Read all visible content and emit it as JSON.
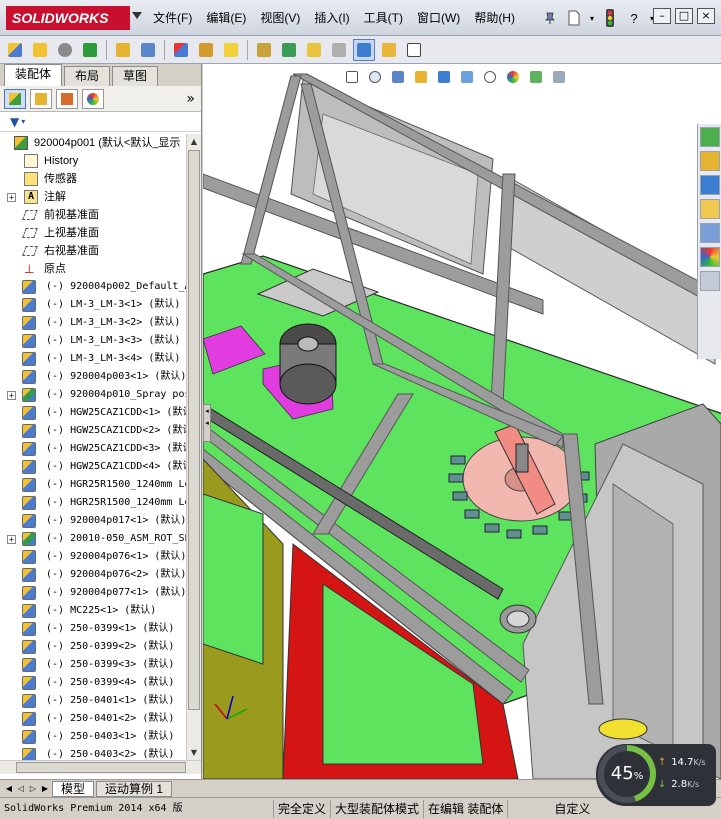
{
  "app": {
    "brand": "SOLIDWORKS",
    "menus": [
      "文件(F)",
      "编辑(E)",
      "视图(V)",
      "插入(I)",
      "工具(T)",
      "窗口(W)",
      "帮助(H)"
    ],
    "help_label": "?"
  },
  "panel": {
    "tabs": [
      "装配体",
      "布局",
      "草图"
    ],
    "active_tab": "装配体"
  },
  "tree": {
    "root": "920004p001  (默认<默认_显示",
    "items": [
      {
        "label": "History",
        "icon": "history-icon",
        "kind": "lvl1",
        "expand": false
      },
      {
        "label": "传感器",
        "icon": "sensor-icon",
        "kind": "lvl1",
        "expand": false
      },
      {
        "label": "注解",
        "icon": "annotation-icon",
        "kind": "lvl1",
        "expand": true
      },
      {
        "label": "前视基准面",
        "icon": "plane-icon",
        "kind": "lvl1",
        "expand": false
      },
      {
        "label": "上视基准面",
        "icon": "plane-icon",
        "kind": "lvl1",
        "expand": false
      },
      {
        "label": "右视基准面",
        "icon": "plane-icon",
        "kind": "lvl1",
        "expand": false
      },
      {
        "label": "原点",
        "icon": "origin-icon",
        "kind": "lvl1",
        "expand": false
      },
      {
        "label": "(-) 920004p002_Default_A",
        "icon": "part-icon",
        "kind": "comp",
        "expand": false
      },
      {
        "label": "(-) LM-3_LM-3<1> (默认)",
        "icon": "part-icon",
        "kind": "comp",
        "expand": false
      },
      {
        "label": "(-) LM-3_LM-3<2> (默认)",
        "icon": "part-icon",
        "kind": "comp",
        "expand": false
      },
      {
        "label": "(-) LM-3_LM-3<3> (默认)",
        "icon": "part-icon",
        "kind": "comp",
        "expand": false
      },
      {
        "label": "(-) LM-3_LM-3<4> (默认)",
        "icon": "part-icon",
        "kind": "comp",
        "expand": false
      },
      {
        "label": "(-) 920004p003<1> (默认)",
        "icon": "part-icon",
        "kind": "comp",
        "expand": false
      },
      {
        "label": "(-) 920004p010_Spray pos",
        "icon": "subassembly-icon",
        "kind": "comp",
        "expand": true
      },
      {
        "label": "(-) HGW25CAZ1CDD<1> (默认",
        "icon": "part-icon",
        "kind": "comp",
        "expand": false
      },
      {
        "label": "(-) HGW25CAZ1CDD<2> (默认",
        "icon": "part-icon",
        "kind": "comp",
        "expand": false
      },
      {
        "label": "(-) HGW25CAZ1CDD<3> (默认",
        "icon": "part-icon",
        "kind": "comp",
        "expand": false
      },
      {
        "label": "(-) HGW25CAZ1CDD<4> (默认",
        "icon": "part-icon",
        "kind": "comp",
        "expand": false
      },
      {
        "label": "(-) HGR25R1500_1240mm Le",
        "icon": "part-icon",
        "kind": "comp",
        "expand": false
      },
      {
        "label": "(-) HGR25R1500_1240mm Le",
        "icon": "part-icon",
        "kind": "comp",
        "expand": false
      },
      {
        "label": "(-) 920004p017<1> (默认)",
        "icon": "part-icon",
        "kind": "comp",
        "expand": false
      },
      {
        "label": "(-) 20010-050_ASM_ROT_SP",
        "icon": "subassembly-icon",
        "kind": "comp",
        "expand": true
      },
      {
        "label": "(-) 920004p076<1> (默认)",
        "icon": "part-icon",
        "kind": "comp",
        "expand": false
      },
      {
        "label": "(-) 920004p076<2> (默认)",
        "icon": "part-icon",
        "kind": "comp",
        "expand": false
      },
      {
        "label": "(-) 920004p077<1> (默认)",
        "icon": "part-icon",
        "kind": "comp",
        "expand": false
      },
      {
        "label": "(-) MC225<1> (默认)",
        "icon": "part-icon",
        "kind": "comp",
        "expand": false
      },
      {
        "label": "(-) 250-0399<1> (默认)",
        "icon": "part-icon",
        "kind": "comp",
        "expand": false
      },
      {
        "label": "(-) 250-0399<2> (默认)",
        "icon": "part-icon",
        "kind": "comp",
        "expand": false
      },
      {
        "label": "(-) 250-0399<3> (默认)",
        "icon": "part-icon",
        "kind": "comp",
        "expand": false
      },
      {
        "label": "(-) 250-0399<4> (默认)",
        "icon": "part-icon",
        "kind": "comp",
        "expand": false
      },
      {
        "label": "(-) 250-0401<1> (默认)",
        "icon": "part-icon",
        "kind": "comp",
        "expand": false
      },
      {
        "label": "(-) 250-0401<2> (默认)",
        "icon": "part-icon",
        "kind": "comp",
        "expand": false
      },
      {
        "label": "(-) 250-0403<1> (默认)",
        "icon": "part-icon",
        "kind": "comp",
        "expand": false
      },
      {
        "label": "(-) 250-0403<2> (默认)",
        "icon": "part-icon",
        "kind": "comp",
        "expand": false
      }
    ]
  },
  "bottom_tabs": [
    "模型",
    "运动算例 1"
  ],
  "status": {
    "app_version": "SolidWorks Premium 2014 x64 版",
    "definition": "完全定义",
    "mode": "大型装配体模式",
    "editing": "在编辑 装配体",
    "units": "自定义"
  },
  "net_monitor": {
    "percent": "45",
    "percent_sign": "%",
    "up_value": "14.7",
    "down_value": "2.8",
    "unit": "K/s",
    "up_color": "#e2a53a",
    "down_color": "#76c043"
  },
  "colors": {
    "brand_red": "#c8102e",
    "frame_grey": "#8a8a8a",
    "plate_green": "#5ee35e",
    "panel_red": "#d51414",
    "panel_olive": "#9a9a1e",
    "disc_pink": "#f2b8b0",
    "magenta": "#e03ce0"
  }
}
